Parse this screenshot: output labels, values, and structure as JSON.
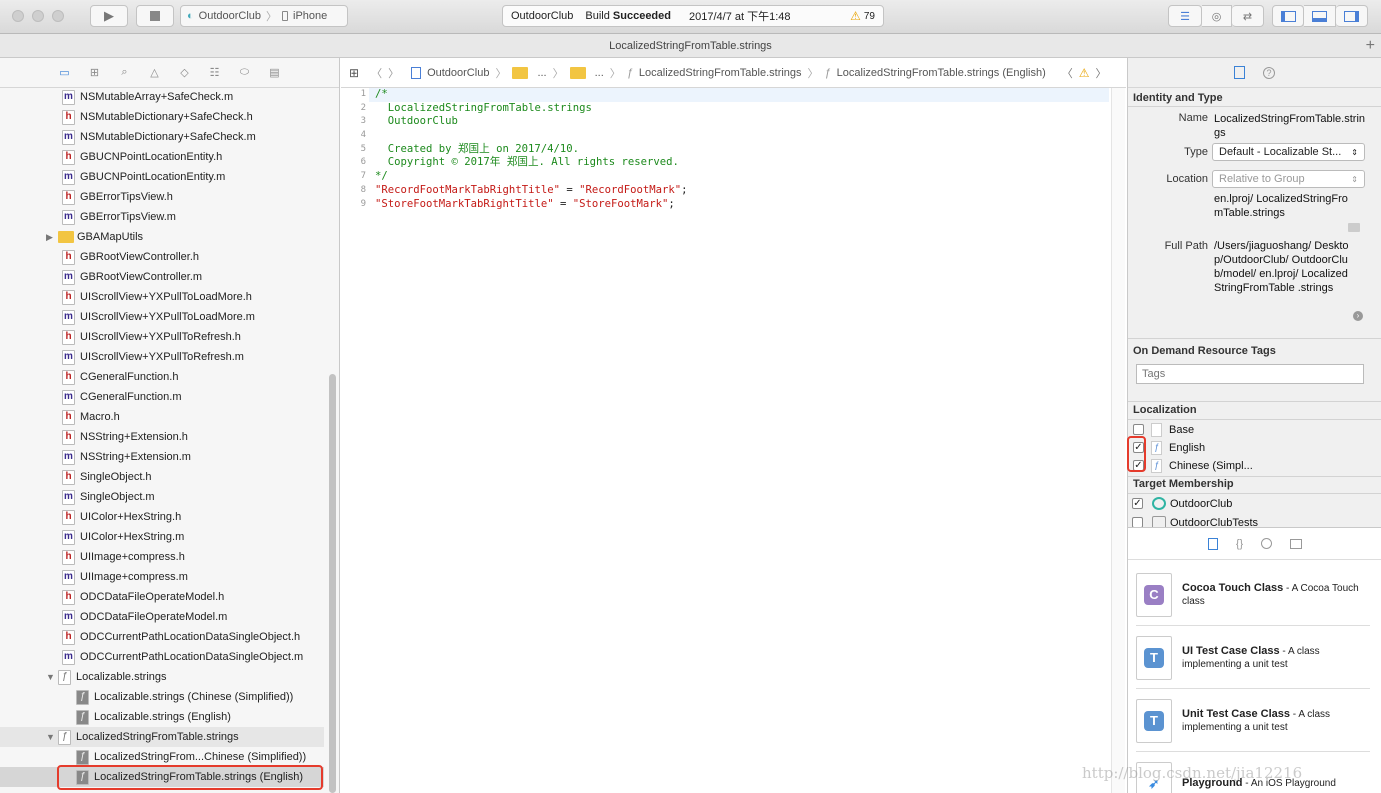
{
  "toolbar": {
    "scheme_target": "OutdoorClub",
    "scheme_device": "iPhone",
    "activity_project": "OutdoorClub",
    "activity_status_prefix": "Build ",
    "activity_status_bold": "Succeeded",
    "activity_time": "2017/4/7 at 下午1:48",
    "warning_count": "79"
  },
  "tab": {
    "title": "LocalizedStringFromTable.strings"
  },
  "navigator": {
    "items": [
      {
        "name": "NSMutableArray+SafeCheck.m",
        "kind": "m"
      },
      {
        "name": "NSMutableDictionary+SafeCheck.h",
        "kind": "h"
      },
      {
        "name": "NSMutableDictionary+SafeCheck.m",
        "kind": "m"
      },
      {
        "name": "GBUCNPointLocationEntity.h",
        "kind": "h"
      },
      {
        "name": "GBUCNPointLocationEntity.m",
        "kind": "m"
      },
      {
        "name": "GBErrorTipsView.h",
        "kind": "h"
      },
      {
        "name": "GBErrorTipsView.m",
        "kind": "m"
      },
      {
        "name": "GBAMapUtils",
        "kind": "folder"
      },
      {
        "name": "GBRootViewController.h",
        "kind": "h"
      },
      {
        "name": "GBRootViewController.m",
        "kind": "m"
      },
      {
        "name": "UIScrollView+YXPullToLoadMore.h",
        "kind": "h"
      },
      {
        "name": "UIScrollView+YXPullToLoadMore.m",
        "kind": "m"
      },
      {
        "name": "UIScrollView+YXPullToRefresh.h",
        "kind": "h"
      },
      {
        "name": "UIScrollView+YXPullToRefresh.m",
        "kind": "m"
      },
      {
        "name": "CGeneralFunction.h",
        "kind": "h"
      },
      {
        "name": "CGeneralFunction.m",
        "kind": "m"
      },
      {
        "name": "Macro.h",
        "kind": "h"
      },
      {
        "name": "NSString+Extension.h",
        "kind": "h"
      },
      {
        "name": "NSString+Extension.m",
        "kind": "m"
      },
      {
        "name": "SingleObject.h",
        "kind": "h"
      },
      {
        "name": "SingleObject.m",
        "kind": "m"
      },
      {
        "name": "UIColor+HexString.h",
        "kind": "h"
      },
      {
        "name": "UIColor+HexString.m",
        "kind": "m"
      },
      {
        "name": "UIImage+compress.h",
        "kind": "h"
      },
      {
        "name": "UIImage+compress.m",
        "kind": "m"
      },
      {
        "name": "ODCDataFileOperateModel.h",
        "kind": "h"
      },
      {
        "name": "ODCDataFileOperateModel.m",
        "kind": "m"
      },
      {
        "name": "ODCCurrentPathLocationDataSingleObject.h",
        "kind": "h"
      },
      {
        "name": "ODCCurrentPathLocationDataSingleObject.m",
        "kind": "m"
      },
      {
        "name": "Localizable.strings",
        "kind": "group"
      },
      {
        "name": "Localizable.strings (Chinese (Simplified))",
        "kind": "sub"
      },
      {
        "name": "Localizable.strings (English)",
        "kind": "sub"
      },
      {
        "name": "LocalizedStringFromTable.strings",
        "kind": "group"
      },
      {
        "name": "LocalizedStringFrom...Chinese (Simplified))",
        "kind": "sub"
      },
      {
        "name": "LocalizedStringFromTable.strings (English)",
        "kind": "sub"
      }
    ]
  },
  "jumpbar": {
    "project": "OutdoorClub",
    "folder1": "...",
    "folder2": "...",
    "file": "LocalizedStringFromTable.strings",
    "variant": "LocalizedStringFromTable.strings (English)"
  },
  "editor": {
    "lines": [
      {
        "n": "1",
        "text": "/*",
        "cls": "cmt"
      },
      {
        "n": "2",
        "text": "  LocalizedStringFromTable.strings",
        "cls": "cmt"
      },
      {
        "n": "3",
        "text": "  OutdoorClub",
        "cls": "cmt"
      },
      {
        "n": "4",
        "text": "",
        "cls": "cmt"
      },
      {
        "n": "5",
        "text": "  Created by 郑国上 on 2017/4/10.",
        "cls": "cmt"
      },
      {
        "n": "6",
        "text": "  Copyright © 2017年 郑国上. All rights reserved.",
        "cls": "cmt"
      },
      {
        "n": "7",
        "text": "*/",
        "cls": "cmt"
      },
      {
        "n": "8",
        "key": "\"RecordFootMarkTabRightTitle\"",
        "eq": " = ",
        "val": "\"RecordFootMark\"",
        "end": ";"
      },
      {
        "n": "9",
        "key": "\"StoreFootMarkTabRightTitle\"",
        "eq": " = ",
        "val": "\"StoreFootMark\"",
        "end": ";"
      }
    ]
  },
  "inspector": {
    "identity_title": "Identity and Type",
    "name_label": "Name",
    "name_value": "LocalizedStringFromTable.strings",
    "type_label": "Type",
    "type_value": "Default - Localizable St...",
    "location_label": "Location",
    "location_value": "Relative to Group",
    "location_path": "en.lproj/ LocalizedStringFromTable.strings",
    "fullpath_label": "Full Path",
    "fullpath_value": "/Users/jiaguoshang/ Desktop/OutdoorClub/ OutdoorClub/model/ en.lproj/ LocalizedStringFromTable .strings",
    "odr_title": "On Demand Resource Tags",
    "tags_placeholder": "Tags",
    "loc_title": "Localization",
    "loc_items": [
      {
        "label": "Base",
        "checked": false
      },
      {
        "label": "English",
        "checked": true
      },
      {
        "label": "Chinese (Simpl...",
        "checked": true
      }
    ],
    "target_title": "Target Membership",
    "targets": [
      {
        "label": "OutdoorClub",
        "checked": true
      },
      {
        "label": "OutdoorClubTests",
        "checked": false
      }
    ]
  },
  "library": {
    "templates": [
      {
        "title": "Cocoa Touch Class",
        "desc": " - A Cocoa Touch class",
        "badge": "C",
        "color": "#9a7fc4"
      },
      {
        "title": "UI Test Case Class",
        "desc": " - A class implementing a unit test",
        "badge": "T",
        "color": "#5b93d1"
      },
      {
        "title": "Unit Test Case Class",
        "desc": " - A class implementing a unit test",
        "badge": "T",
        "color": "#5b93d1"
      },
      {
        "title": "Playground",
        "desc": " - An iOS Playground",
        "badge": "",
        "color": "#3a8be0"
      }
    ]
  },
  "watermark": "http://blog.csdn.net/jia12216",
  "colors": {
    "accent_red": "#e53b2c",
    "comment_green": "#1d8a1d",
    "string_red": "#c41a16",
    "selection": "#d6d6d6"
  }
}
